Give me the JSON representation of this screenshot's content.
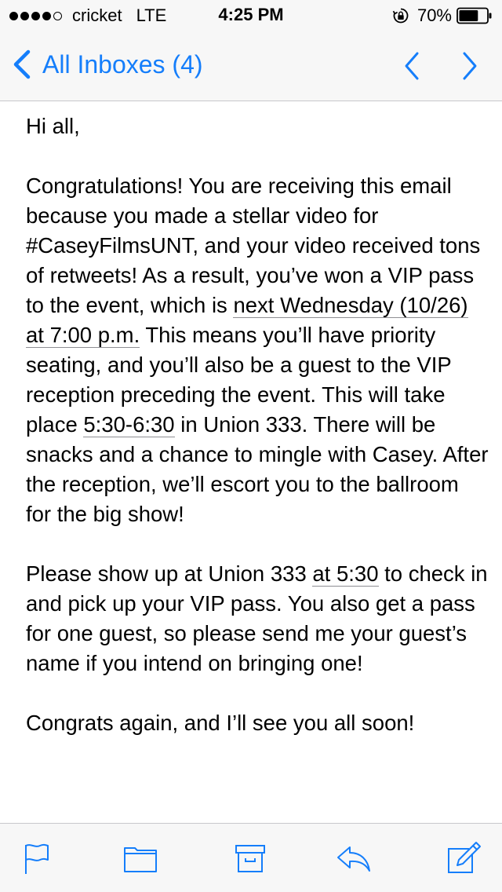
{
  "status_bar": {
    "carrier": "cricket",
    "network": "LTE",
    "time": "4:25 PM",
    "battery_percent": "70%",
    "signal_bars_filled": 4,
    "signal_bars_total": 5,
    "battery_level": 0.7
  },
  "nav": {
    "back_label": "All Inboxes (4)",
    "accent_color": "#157efb"
  },
  "email": {
    "greeting": "Hi all,",
    "p1": {
      "a": "Congratulations! You are receiving this email because you made a stellar video for #CaseyFilmsUNT, and your video received tons of retweets! As a result, you’ve won a VIP pass to the event, which is ",
      "date_link": "next Wednesday (10/26) at 7:00 p.m.",
      "b": " This means you’ll have priority seating, and you’ll also be a guest to the VIP reception preceding the event. This will take place ",
      "time_link": "5:30-6:30",
      "c": " in Union 333. There will be snacks and a chance to mingle with Casey. After the reception, we’ll escort you to the ballroom for the big show!"
    },
    "p2": {
      "a": "Please show up at Union 333 ",
      "time_link": "at 5:30",
      "b": " to check in and pick up your VIP pass. You also get a pass for one guest, so please send me your guest’s name if you intend on bringing one!"
    },
    "closing": "Congrats again, and I’ll see you all soon!"
  },
  "toolbar": {
    "icons": [
      "flag-icon",
      "folder-icon",
      "archive-icon",
      "reply-icon",
      "compose-icon"
    ]
  }
}
